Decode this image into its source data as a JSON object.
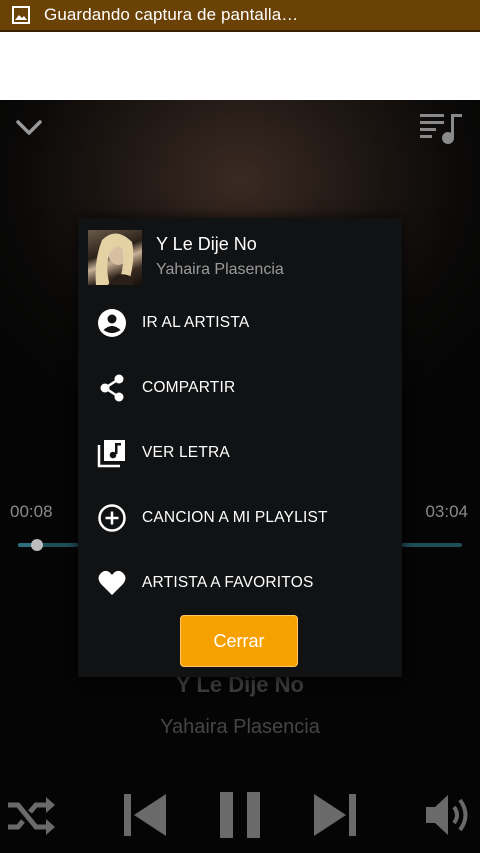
{
  "status_bar": {
    "notification_text": "Guardando captura de pantalla…",
    "icon": "image-icon"
  },
  "player": {
    "elapsed": "00:08",
    "duration": "03:04",
    "progress": 0.043,
    "song_title": "Y Le Dije No",
    "artist": "Yahaira Plasencia"
  },
  "dialog": {
    "song_title": "Y Le Dije No",
    "artist": "Yahaira Plasencia",
    "items": [
      {
        "label": "IR AL ARTISTA",
        "icon": "account-circle-icon"
      },
      {
        "label": "COMPARTIR",
        "icon": "share-icon"
      },
      {
        "label": "VER LETRA",
        "icon": "lyrics-icon"
      },
      {
        "label": "CANCION A MI PLAYLIST",
        "icon": "add-circle-icon"
      },
      {
        "label": "ARTISTA A FAVORITOS",
        "icon": "heart-icon"
      }
    ],
    "close_label": "Cerrar"
  },
  "colors": {
    "accent": "#f7a100",
    "status_bar": "#6b4206",
    "progress": "#2d6f7e"
  }
}
